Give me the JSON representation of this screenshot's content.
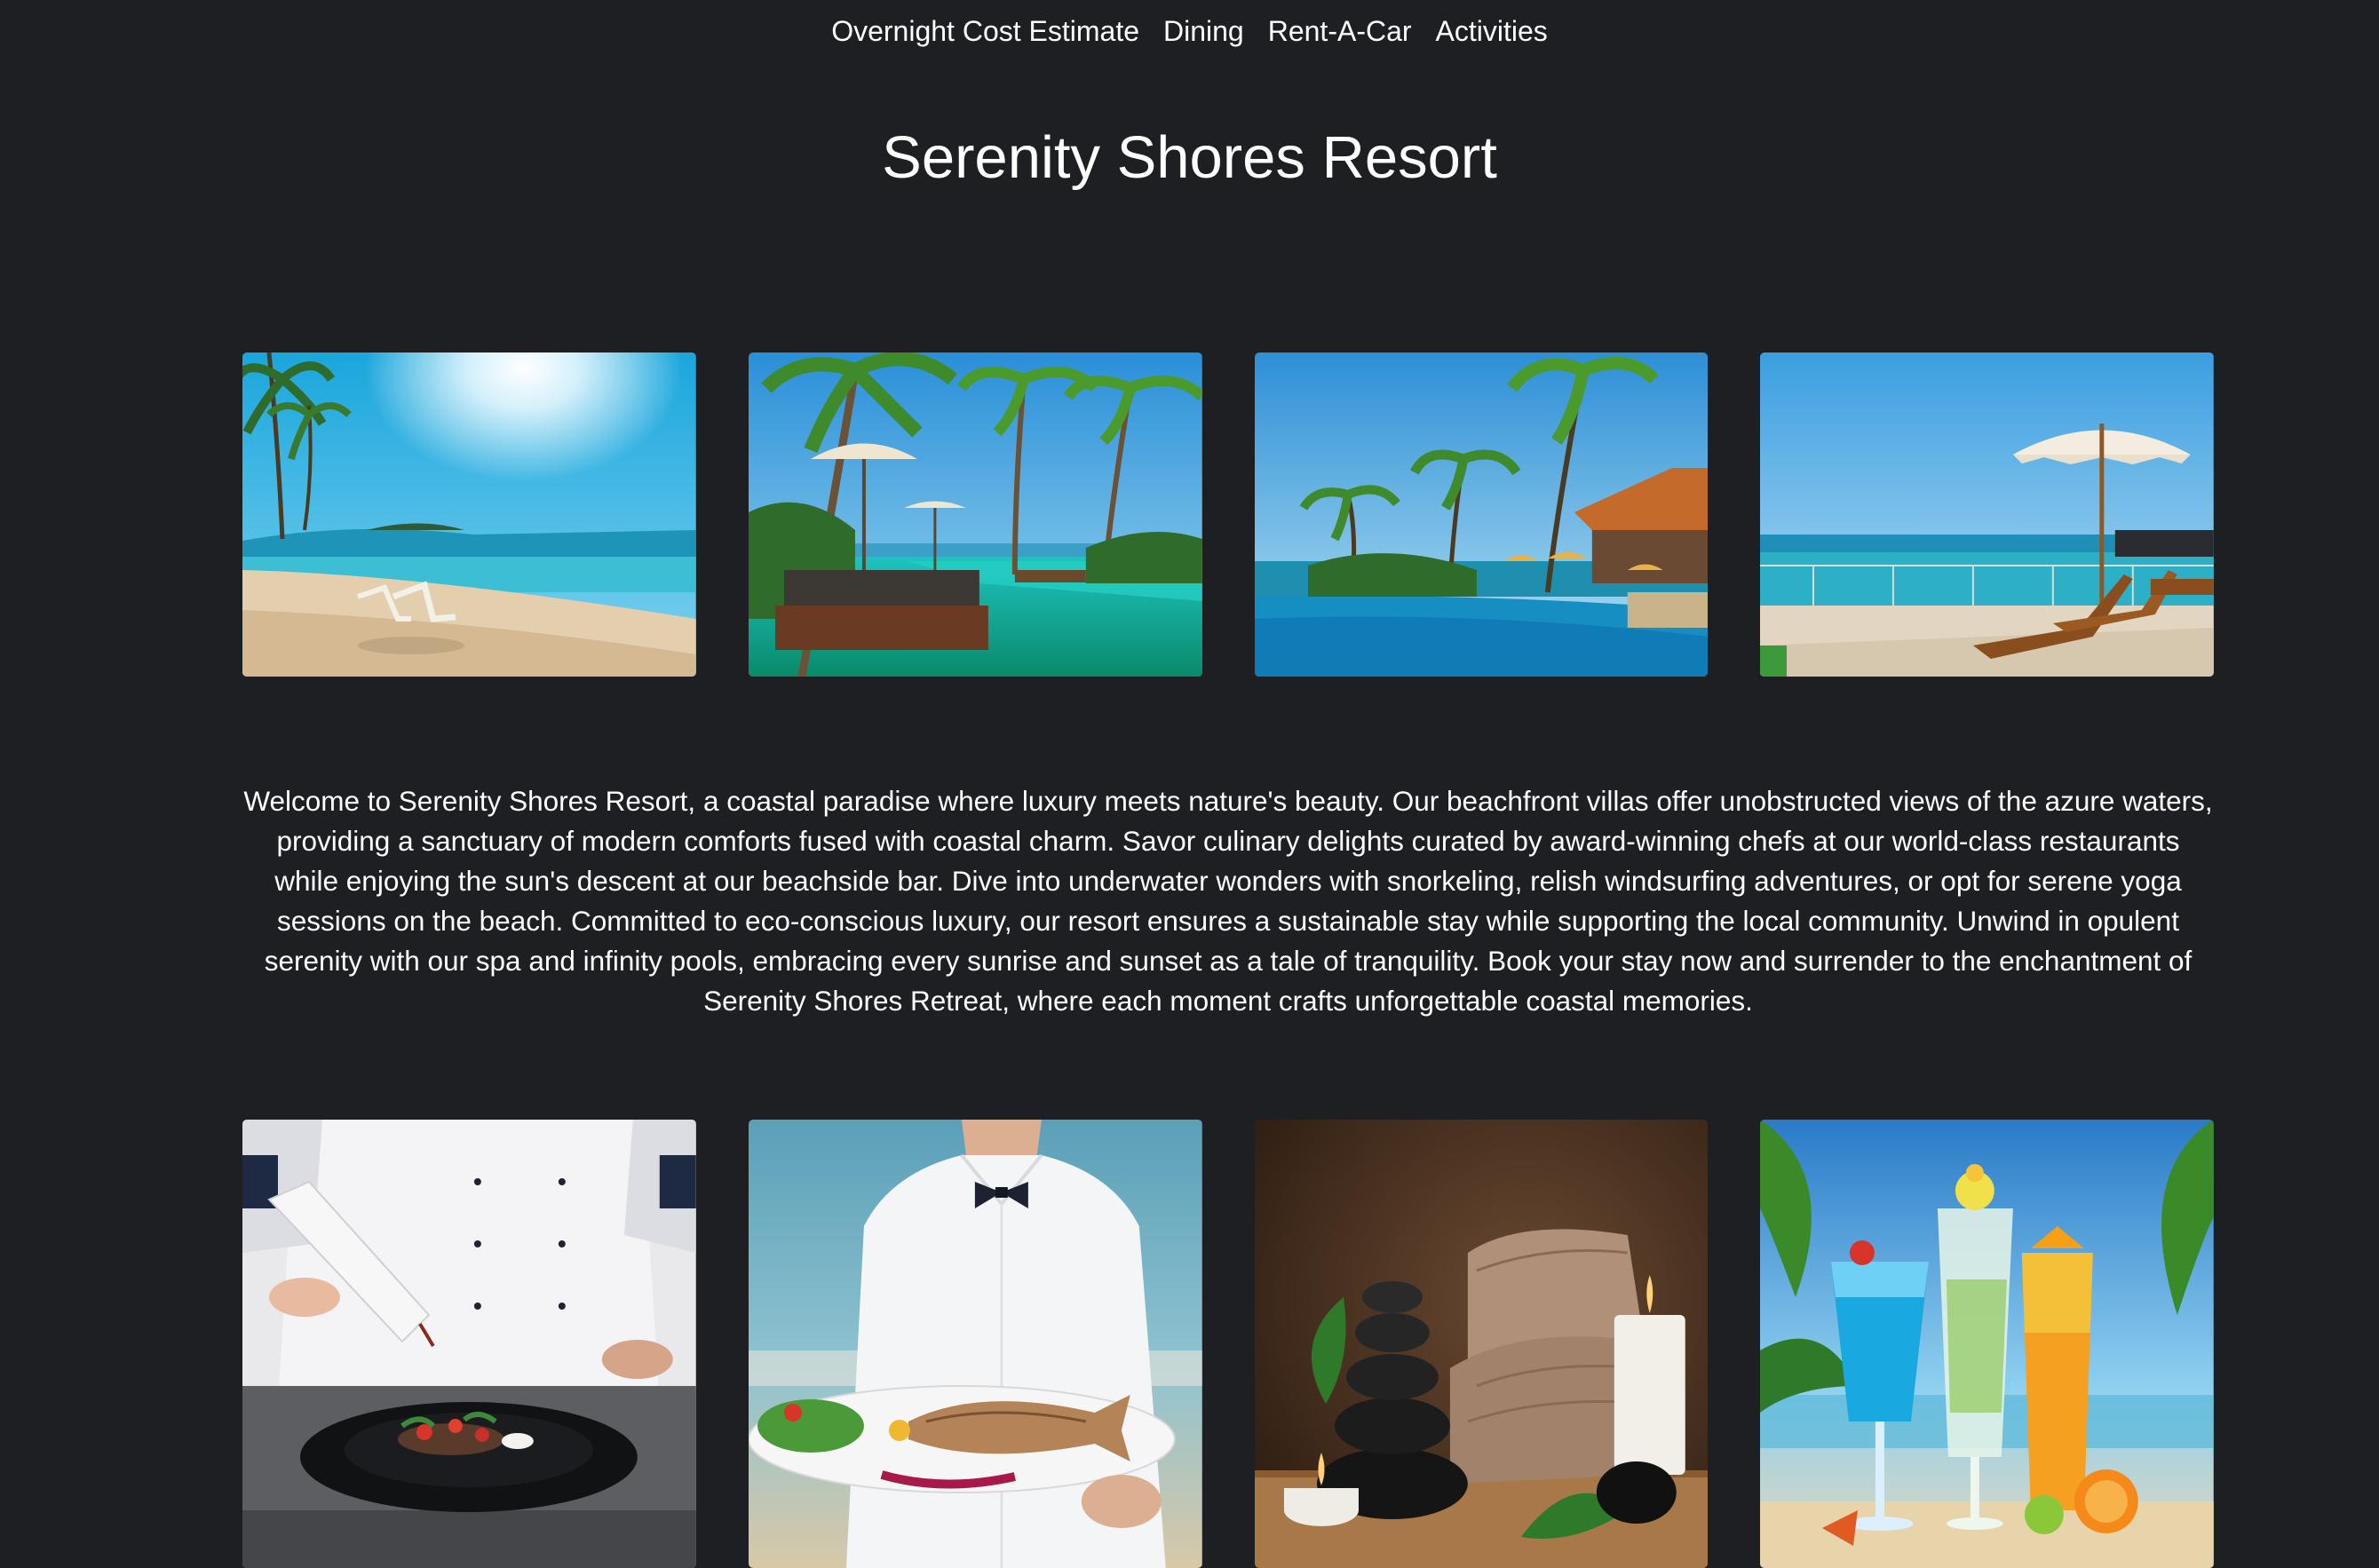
{
  "nav": {
    "items": [
      {
        "label": "Overnight Cost Estimate"
      },
      {
        "label": "Dining"
      },
      {
        "label": "Rent-A-Car"
      },
      {
        "label": "Activities"
      }
    ]
  },
  "header": {
    "title": "Serenity Shores Resort"
  },
  "main": {
    "description": "Welcome to Serenity Shores Resort, a coastal paradise where luxury meets nature's beauty. Our beachfront villas offer unobstructed views of the azure waters, providing a sanctuary of modern comforts fused with coastal charm. Savor culinary delights curated by award-winning chefs at our world-class restaurants while enjoying the sun's descent at our beachside bar. Dive into underwater wonders with snorkeling, relish windsurfing adventures, or opt for serene yoga sessions on the beach. Committed to eco-conscious luxury, our resort ensures a sustainable stay while supporting the local community. Unwind in opulent serenity with our spa and infinity pools, embracing every sunrise and sunset as a tale of tranquility. Book your stay now and surrender to the enchantment of Serenity Shores Retreat, where each moment crafts unforgettable coastal memories."
  },
  "colors": {
    "background": "#1e1f23",
    "text": "#ffffff"
  }
}
